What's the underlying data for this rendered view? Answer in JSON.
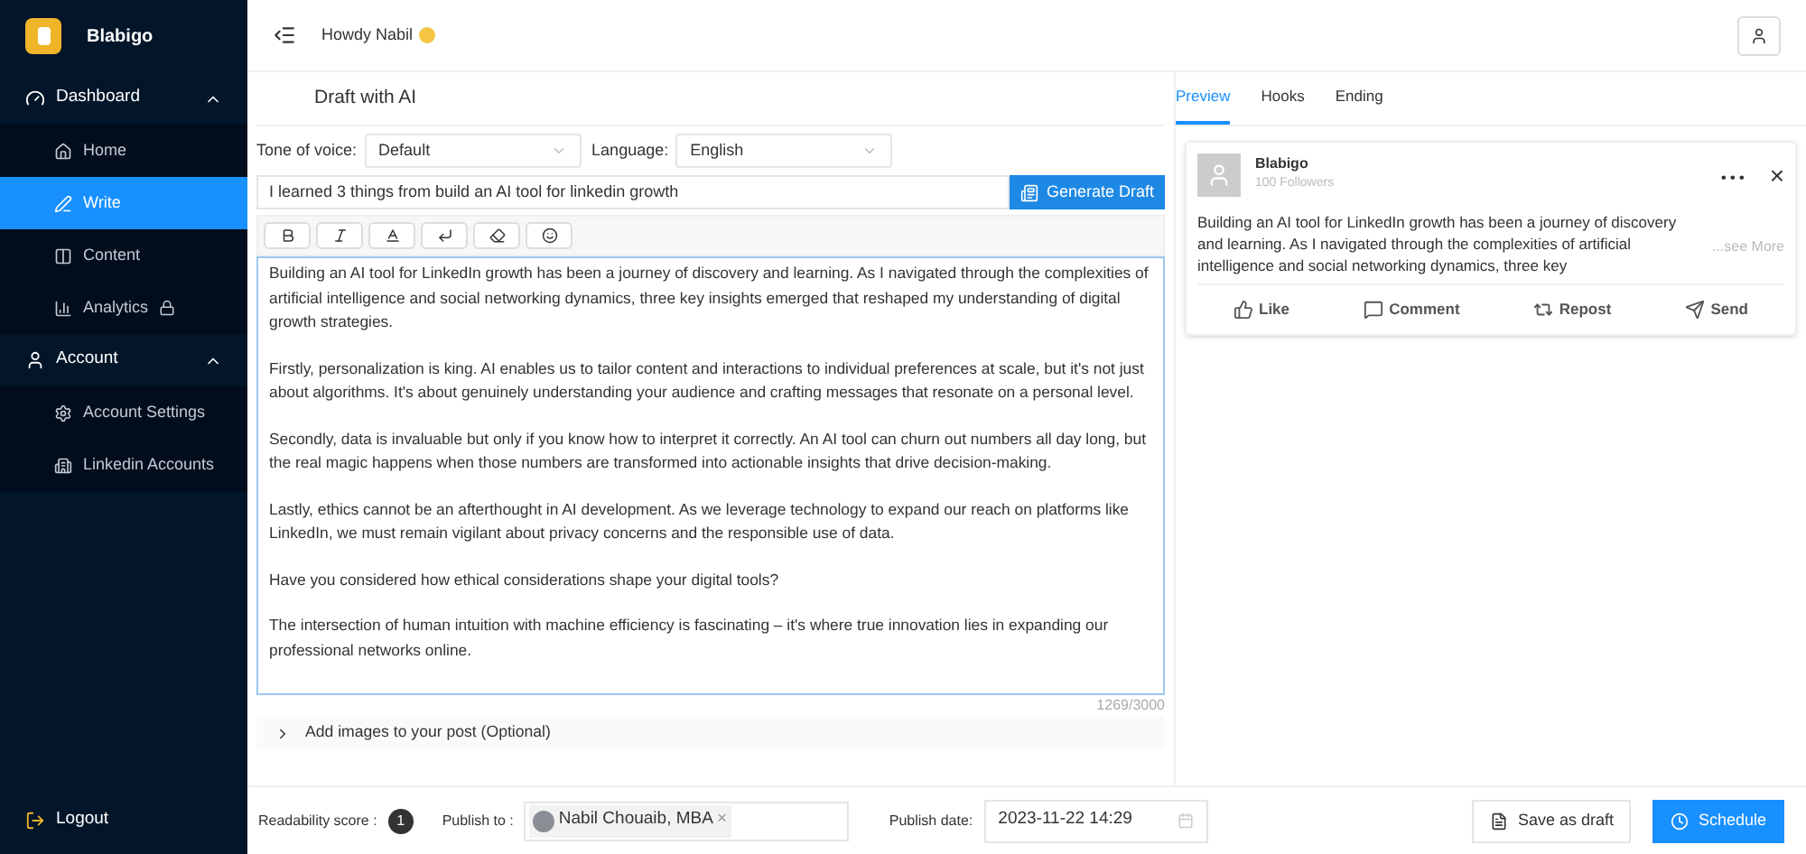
{
  "brand": {
    "name": "Blabigo"
  },
  "sidebar": {
    "sections": [
      {
        "label": "Dashboard",
        "expanded": true,
        "children": [
          {
            "label": "Home",
            "selected": false,
            "locked": false
          },
          {
            "label": "Write",
            "selected": true,
            "locked": false
          },
          {
            "label": "Content",
            "selected": false,
            "locked": false
          },
          {
            "label": "Analytics",
            "selected": false,
            "locked": true
          }
        ]
      },
      {
        "label": "Account",
        "expanded": true,
        "children": [
          {
            "label": "Account Settings",
            "selected": false,
            "locked": false
          },
          {
            "label": "Linkedin Accounts",
            "selected": false,
            "locked": false
          }
        ]
      }
    ],
    "logout": "Logout"
  },
  "header": {
    "greeting": "Howdy Nabil"
  },
  "editor": {
    "title": "Draft with AI",
    "tone": {
      "label": "Tone of voice:",
      "value": "Default"
    },
    "language": {
      "label": "Language:",
      "value": "English"
    },
    "prompt": "I learned 3 things from build an AI tool for linkedin growth",
    "generate_button": "Generate Draft",
    "paragraphs": [
      "Building an AI tool for LinkedIn growth has been a journey of discovery and learning. As I navigated through the complexities of artificial intelligence and social networking dynamics, three key insights emerged that reshaped my understanding of digital growth strategies.",
      "Firstly, personalization is king. AI enables us to tailor content and interactions to individual preferences at scale, but it's not just about algorithms. It's about genuinely understanding your audience and crafting messages that resonate on a personal level.",
      "Secondly, data is invaluable but only if you know how to interpret it correctly. An AI tool can churn out numbers all day long, but the real magic happens when those numbers are transformed into actionable insights that drive decision-making.",
      "Lastly, ethics cannot be an afterthought in AI development. As we leverage technology to expand our reach on platforms like LinkedIn, we must remain vigilant about privacy concerns and the responsible use of data.",
      "Have you considered how ethical considerations shape your digital tools?",
      "The intersection of human intuition with machine efficiency is fascinating – it's where true innovation lies in expanding our professional networks online."
    ],
    "counter": "1269/3000",
    "images_toggle": {
      "label": "Add images to your post (Optional)",
      "expanded": false
    }
  },
  "tabs": [
    {
      "label": "Preview",
      "selected": true
    },
    {
      "label": "Hooks",
      "selected": false
    },
    {
      "label": "Ending",
      "selected": false
    }
  ],
  "preview": {
    "name": "Blabigo",
    "followers": "100 Followers",
    "menu": "• • •",
    "close": "×",
    "text": "Building an AI tool for LinkedIn growth has been a journey of discovery and learning. As I navigated through the complexities of artificial intelligence and social networking dynamics, three key",
    "see_more": "...see More",
    "actions": [
      {
        "label": "Like"
      },
      {
        "label": "Comment"
      },
      {
        "label": "Repost"
      },
      {
        "label": "Send"
      }
    ]
  },
  "footer": {
    "readability_label": "Readability score :",
    "readability_score": "1",
    "publish_to_label": "Publish to :",
    "publish_to": "Nabil Chouaib, MBA",
    "remove": "×",
    "publish_date_label": "Publish date:",
    "publish_date": "2023-11-22 14:29",
    "save_button": "Save as draft",
    "schedule_button": "Schedule"
  }
}
